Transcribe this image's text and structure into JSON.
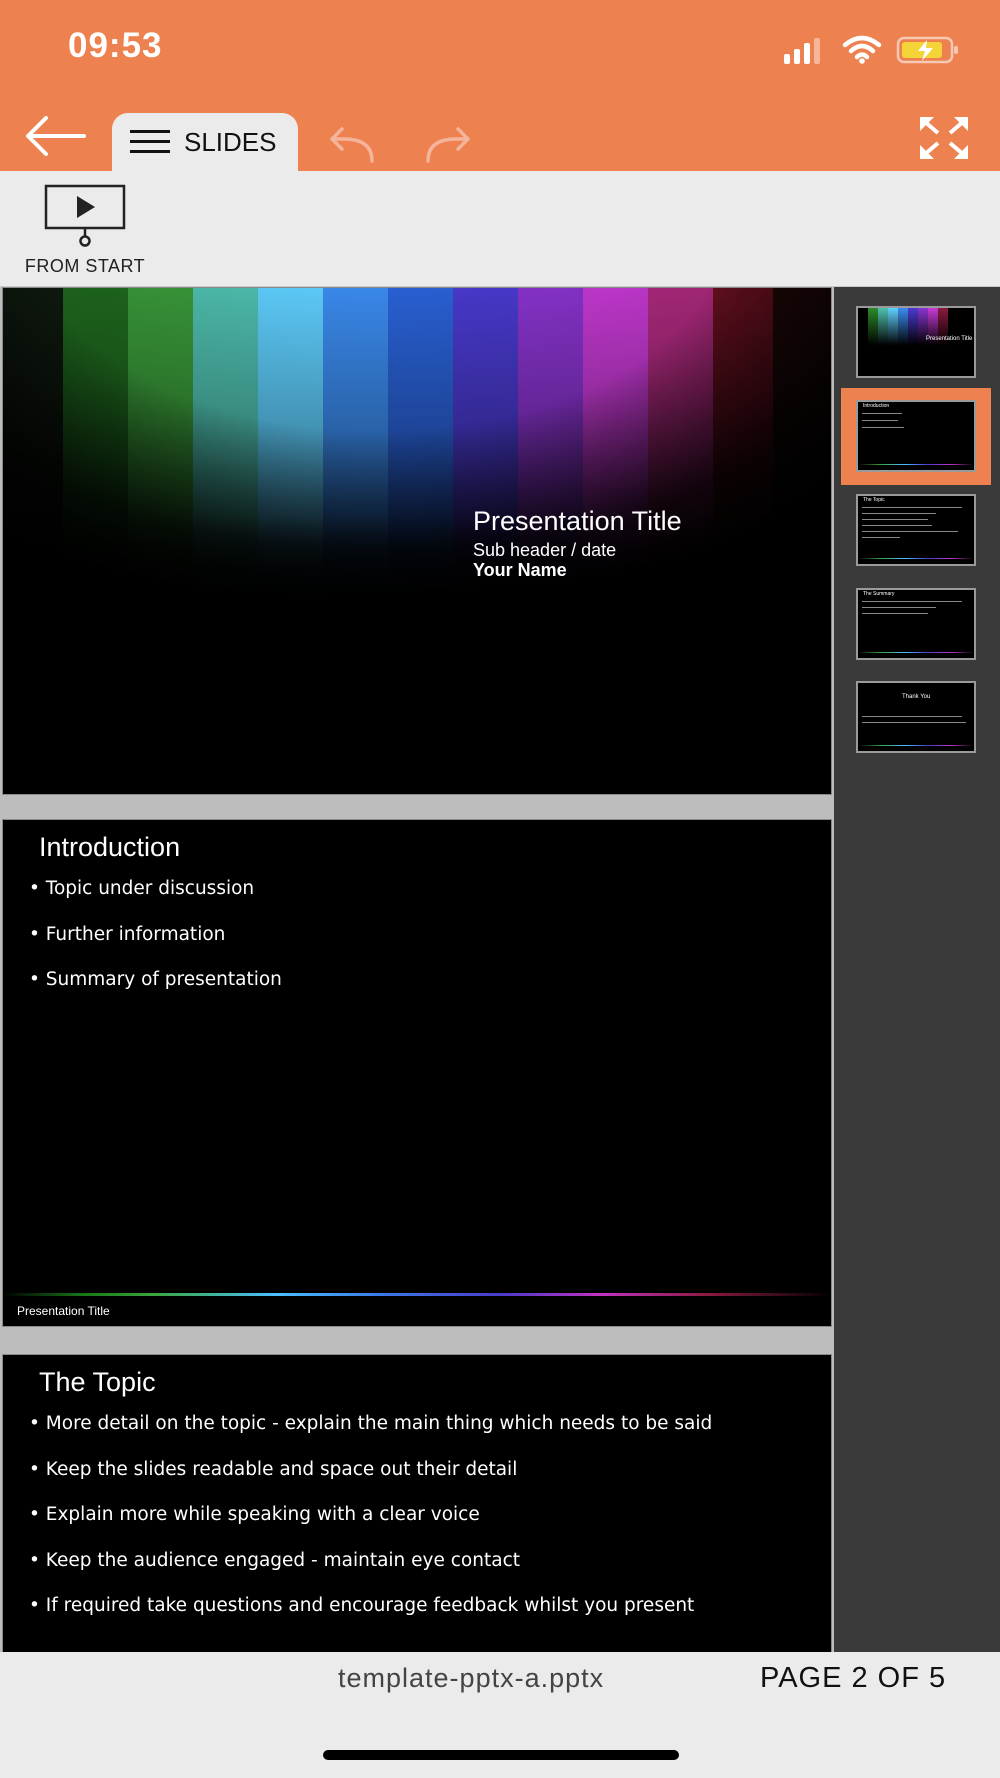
{
  "status_bar": {
    "time": "09:53",
    "icons": [
      "signal-icon",
      "wifi-icon",
      "battery-charging-icon"
    ]
  },
  "header": {
    "tab_label": "SLIDES",
    "buttons": [
      "back-arrow-icon",
      "menu-icon",
      "undo-icon",
      "redo-icon",
      "fullscreen-icon"
    ]
  },
  "toolbar": {
    "from_start_label": "FROM START"
  },
  "slides": [
    {
      "title": "Presentation Title",
      "subtitle": "Sub header / date",
      "author": "Your Name"
    },
    {
      "title": "Introduction",
      "bullets": [
        "• Topic under discussion",
        "• Further information",
        "• Summary of presentation"
      ],
      "footer": "Presentation Title"
    },
    {
      "title": "The Topic",
      "bullets": [
        "• More detail on the topic - explain the main thing which needs to be said",
        "• Keep the slides readable and space out their detail",
        "• Explain more while speaking with a clear voice",
        "• Keep the audience engaged - maintain eye contact",
        "• If required take questions and encourage feedback whilst you present"
      ]
    }
  ],
  "thumbnails": {
    "count": 5,
    "selected_index": 2,
    "labels": [
      "Presentation Title",
      "Introduction",
      "The Topic",
      "The Summary",
      "Thank You"
    ]
  },
  "footer_bar": {
    "filename": "template-pptx-a.pptx",
    "page_indicator": "PAGE 2 OF 5"
  },
  "colors": {
    "accent": "#ee8150",
    "background": "#ebebeb",
    "thumb_panel": "#3a3a3a"
  }
}
